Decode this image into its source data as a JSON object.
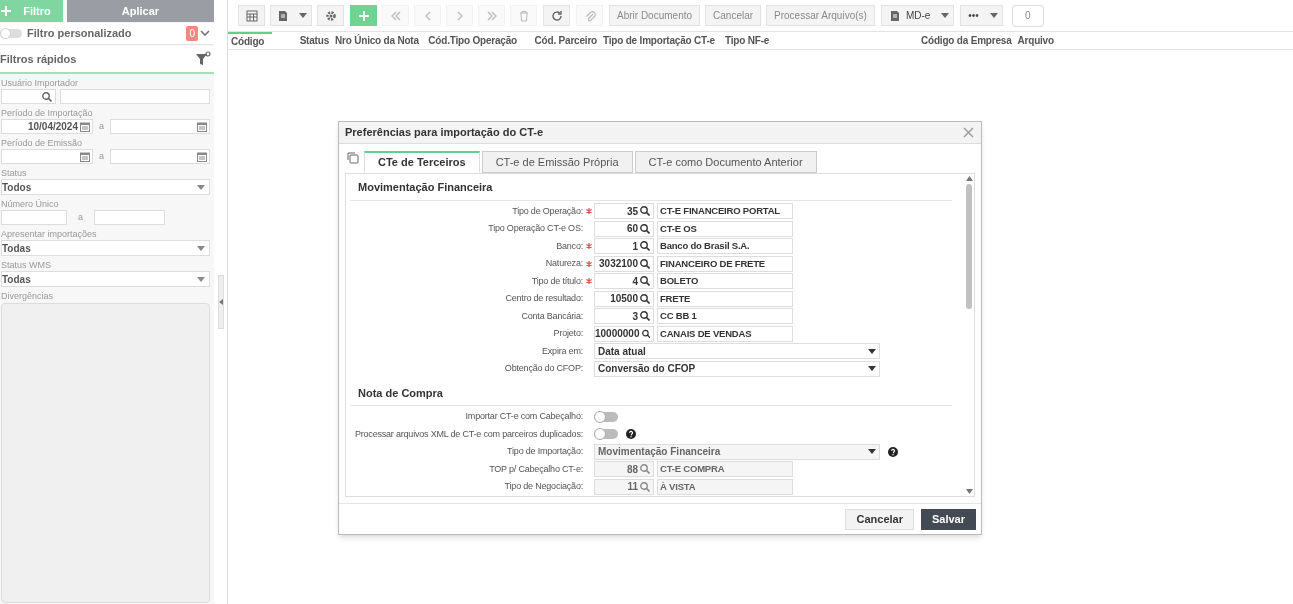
{
  "sidebar": {
    "filter_button": "Filtro",
    "apply_button": "Aplicar",
    "custom_filter": {
      "label": "Filtro personalizado",
      "on": false,
      "count": "0"
    },
    "quick_filters_title": "Filtros rápidos",
    "fields": [
      {
        "kind": "lookup",
        "label": "Usuário Importador"
      },
      {
        "kind": "date_range",
        "label": "Período de Importação",
        "from": "10/04/2024",
        "separator": "a"
      },
      {
        "kind": "date_range",
        "label": "Período de Emissão",
        "separator": "a"
      },
      {
        "kind": "select",
        "label": "Status",
        "value": "Todos"
      },
      {
        "kind": "range",
        "label": "Número Único",
        "separator": "a"
      },
      {
        "kind": "select",
        "label": "Apresentar importações",
        "value": "Todas"
      },
      {
        "kind": "select",
        "label": "Status WMS",
        "value": "Todas"
      },
      {
        "kind": "textarea",
        "label": "Divergências"
      }
    ]
  },
  "toolbar": {
    "items": [
      {
        "kind": "icon",
        "disabled": false,
        "caret": false
      },
      {
        "kind": "icon",
        "disabled": false,
        "caret": true
      },
      {
        "kind": "icon",
        "disabled": false,
        "caret": false
      },
      {
        "kind": "add",
        "disabled": false,
        "caret": false
      },
      {
        "kind": "icon",
        "disabled": true,
        "caret": false
      },
      {
        "kind": "icon",
        "disabled": true,
        "caret": false
      },
      {
        "kind": "icon",
        "disabled": true,
        "caret": false
      },
      {
        "kind": "icon",
        "disabled": true,
        "caret": false
      },
      {
        "kind": "icon",
        "disabled": true,
        "caret": false
      },
      {
        "kind": "icon",
        "disabled": false,
        "caret": false
      },
      {
        "kind": "icon",
        "disabled": true,
        "caret": false
      },
      {
        "kind": "text",
        "label": "Abrir Documento",
        "disabled": true,
        "caret": false
      },
      {
        "kind": "text",
        "label": "Cancelar",
        "disabled": true,
        "caret": false
      },
      {
        "kind": "text",
        "label": "Processar Arquivo(s)",
        "disabled": true,
        "caret": false
      },
      {
        "kind": "icon_text",
        "label": "MD-e",
        "disabled": false,
        "caret": true
      },
      {
        "kind": "text",
        "label": "•••",
        "disabled": false,
        "caret": true
      }
    ],
    "counter": "0"
  },
  "table": {
    "columns": [
      "Código",
      "Status",
      "Nro Único da Nota",
      "Cód.Tipo Operação",
      "Cód. Parceiro",
      "Tipo de Importação CT-e",
      "Tipo NF-e",
      "Código da Empresa",
      "Arquivo"
    ]
  },
  "dialog": {
    "title": "Preferências para importação do CT-e",
    "tabs": [
      {
        "label": "CTe de Terceiros",
        "selected": true
      },
      {
        "label": "CT-e de Emissão Própria",
        "selected": false
      },
      {
        "label": "CT-e como Documento Anterior",
        "selected": false
      }
    ],
    "sections": [
      {
        "title": "Movimentação Financeira",
        "rows": [
          {
            "kind": "lookup",
            "label": "Tipo de Operação:",
            "required": true,
            "disabled": false,
            "code": "35",
            "description": "CT-E FINANCEIRO PORTAL"
          },
          {
            "kind": "lookup",
            "label": "Tipo Operação CT-e OS:",
            "required": false,
            "disabled": false,
            "code": "60",
            "description": "CT-E OS"
          },
          {
            "kind": "lookup",
            "label": "Banco:",
            "required": true,
            "disabled": false,
            "code": "1",
            "description": "Banco do Brasil S.A."
          },
          {
            "kind": "lookup",
            "label": "Natureza:",
            "required": true,
            "disabled": false,
            "code": "3032100",
            "description": "FINANCEIRO DE FRETE"
          },
          {
            "kind": "lookup",
            "label": "Tipo de título:",
            "required": true,
            "disabled": false,
            "code": "4",
            "description": "BOLETO"
          },
          {
            "kind": "lookup",
            "label": "Centro de resultado:",
            "required": false,
            "disabled": false,
            "code": "10500",
            "description": "FRETE"
          },
          {
            "kind": "lookup",
            "label": "Conta Bancária:",
            "required": false,
            "disabled": false,
            "code": "3",
            "description": "CC BB 1"
          },
          {
            "kind": "lookup",
            "label": "Projeto:",
            "required": false,
            "disabled": false,
            "code": "10000000",
            "description": "CANAIS DE VENDAS"
          },
          {
            "kind": "select",
            "label": "Expira em:",
            "disabled": false,
            "help": false,
            "value": "Data atual"
          },
          {
            "kind": "select",
            "label": "Obtenção do CFOP:",
            "disabled": false,
            "help": false,
            "value": "Conversão do CFOP"
          }
        ]
      },
      {
        "title": "Nota de Compra",
        "rows": [
          {
            "kind": "toggle",
            "label": "Importar CT-e com Cabeçalho:",
            "on": false,
            "help": false
          },
          {
            "kind": "toggle",
            "label": "Processar arquivos XML de CT-e com parceiros duplicados:",
            "on": false,
            "help": true
          },
          {
            "kind": "select",
            "label": "Tipo de Importação:",
            "disabled": true,
            "help": true,
            "value": "Movimentação Financeira"
          },
          {
            "kind": "lookup",
            "label": "TOP p/ Cabeçalho CT-e:",
            "required": false,
            "disabled": true,
            "code": "88",
            "description": "CT-E COMPRA"
          },
          {
            "kind": "lookup",
            "label": "Tipo de Negociação:",
            "required": false,
            "disabled": true,
            "code": "11",
            "description": "À VISTA"
          }
        ]
      }
    ],
    "buttons": [
      {
        "label": "Cancelar",
        "kind": "secondary"
      },
      {
        "label": "Salvar",
        "kind": "primary"
      }
    ]
  }
}
